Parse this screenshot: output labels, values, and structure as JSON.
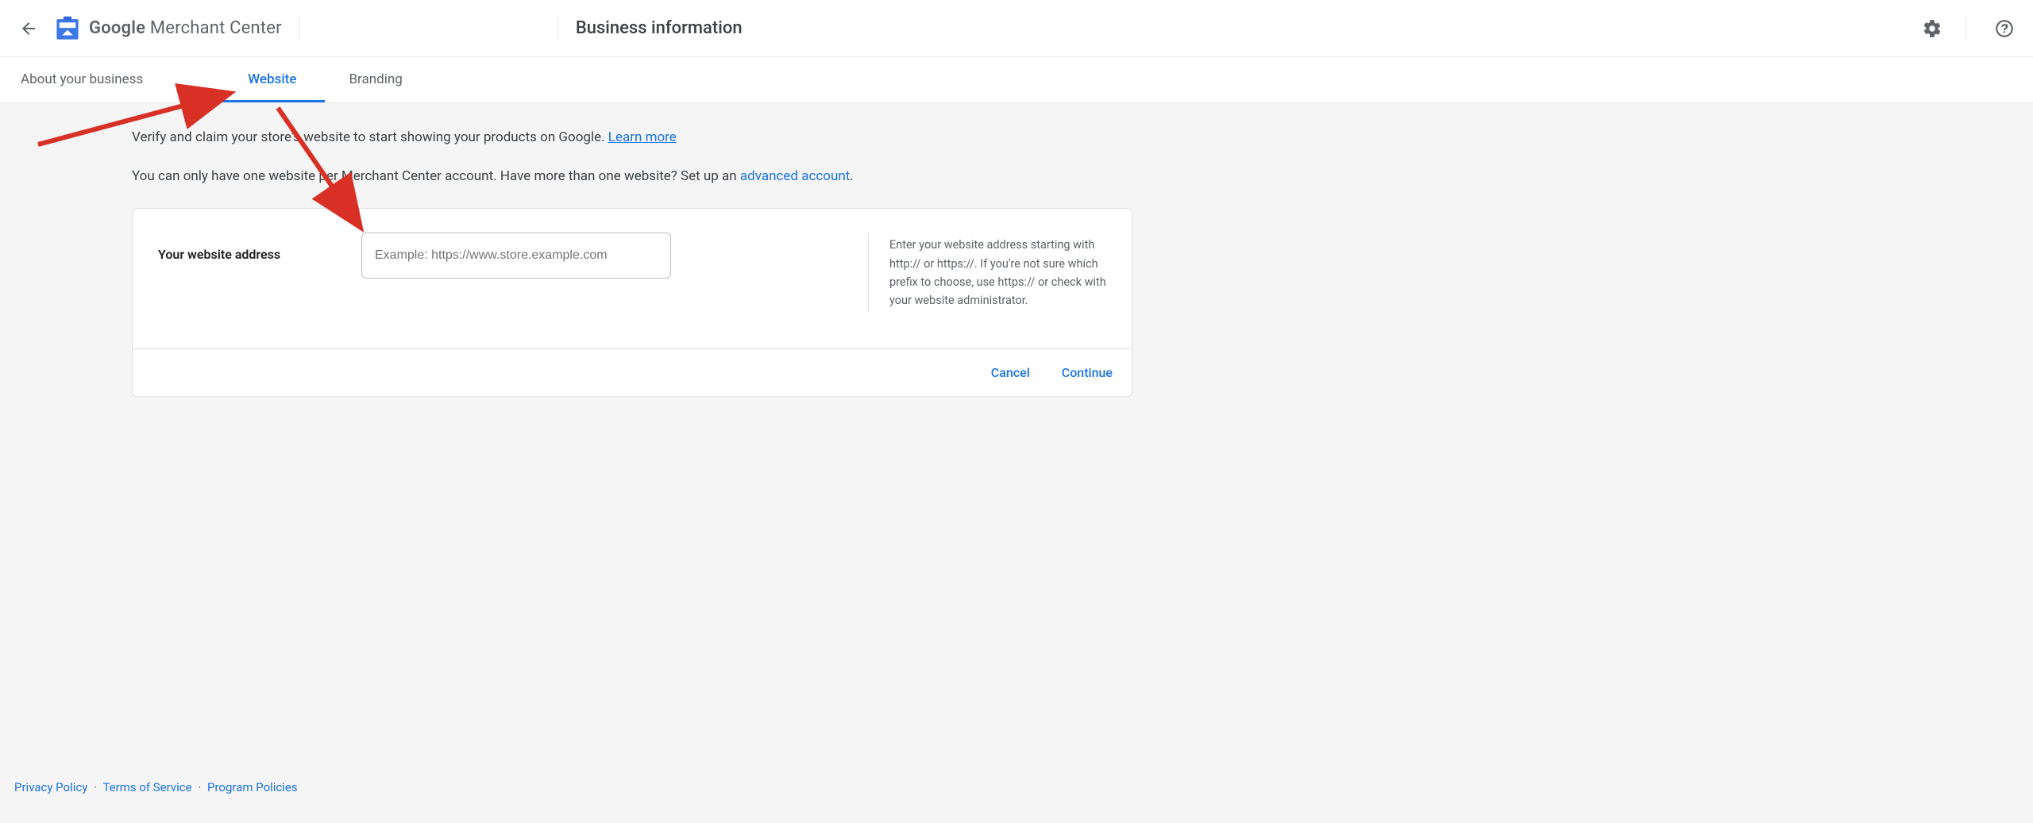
{
  "header": {
    "brand_bold": "Google",
    "brand_rest": " Merchant Center",
    "page_title": "Business information"
  },
  "tabs": [
    {
      "label": "About your business",
      "active": false
    },
    {
      "label": "Website",
      "active": true
    },
    {
      "label": "Branding",
      "active": false
    }
  ],
  "intro": {
    "line1_a": "Verify and claim your store's website to start showing your products on Google. ",
    "line1_link": "Learn more",
    "line2_a": "You can only have one website per Merchant Center account. Have more than one website? Set up an ",
    "line2_link": "advanced account",
    "line2_b": "."
  },
  "card": {
    "field_label": "Your website address",
    "input_value": "",
    "input_placeholder": "Example: https://www.store.example.com",
    "hint": "Enter your website address starting with http:// or https://. If you're not sure which prefix to choose, use https:// or check with your website administrator.",
    "cancel": "Cancel",
    "continue": "Continue"
  },
  "footer": {
    "privacy": "Privacy Policy",
    "terms": "Terms of Service",
    "program": "Program Policies"
  }
}
